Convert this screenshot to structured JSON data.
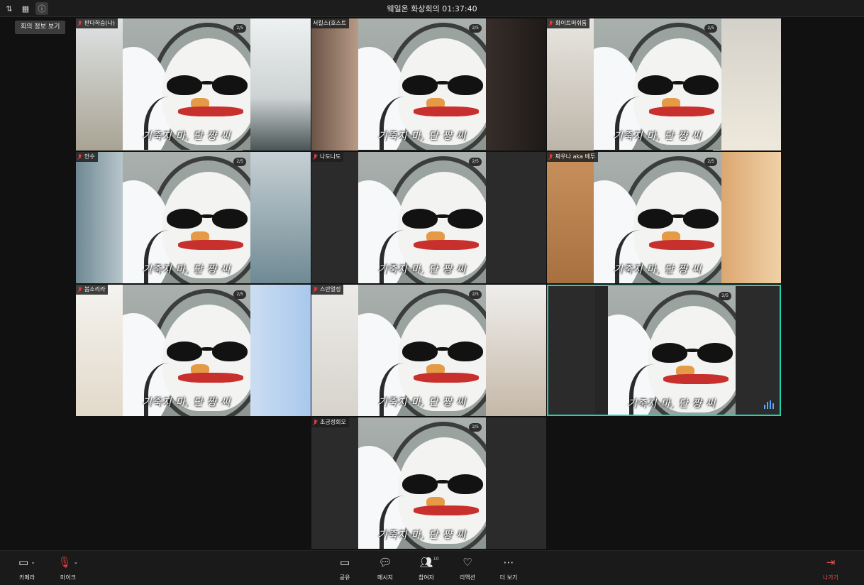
{
  "window": {
    "title": "웨일온 화상회의 01:37:40"
  },
  "topbar": {
    "tooltip": "회의 정보 보기",
    "icons": [
      "sort-icon",
      "grid-icon",
      "info-icon"
    ]
  },
  "tiles": [
    {
      "name": "판다하숭(나)",
      "badge": "2/5",
      "caption": "기죽지 마, 단 쨩 씨",
      "background": "room"
    },
    {
      "name": "서킬스(호스트",
      "badge": "2/5",
      "caption": "기죽지 마, 단 쨩 씨",
      "background": "warm"
    },
    {
      "name": "화이트머쉬룸",
      "badge": "2/5",
      "caption": "기죽지 마, 단 쨩 씨",
      "background": "hall"
    },
    {
      "name": "안수",
      "badge": "2/5",
      "caption": "기죽지 마, 단 쨩 씨",
      "background": "blue"
    },
    {
      "name": "나도나도",
      "badge": "2/5",
      "caption": "기죽지 마, 단 쨩 씨",
      "background": "dark"
    },
    {
      "name": "짜우나 aka 베투",
      "badge": "2/5",
      "caption": "기죽지 마, 단 쨩 씨",
      "background": "wood"
    },
    {
      "name": "봄소리라",
      "badge": "2/5",
      "caption": "기죽지 마, 단 쨩 씨",
      "background": "light"
    },
    {
      "name": "스만열정",
      "badge": "2/5",
      "caption": "기죽지 마, 단 쨩 씨",
      "background": "pale"
    },
    {
      "name": "",
      "badge": "2/5",
      "caption": "기죽지 마, 단 쨩 씨",
      "background": "dark",
      "speaking": true
    },
    {
      "name": "초긍정회오",
      "badge": "2/5",
      "caption": "기죽지 마, 단 쨩 씨",
      "background": "dark"
    }
  ],
  "toolbar": {
    "camera": "카메라",
    "mic": "마이크",
    "share": "공유",
    "message": "메시지",
    "participants": "참여자",
    "participants_count": "10",
    "reaction": "리액션",
    "more": "더 보기",
    "leave": "나가기"
  },
  "colors": {
    "speaking": "#1fd6b0",
    "mic_off": "#e03b3b",
    "leave": "#ee4a4a"
  }
}
